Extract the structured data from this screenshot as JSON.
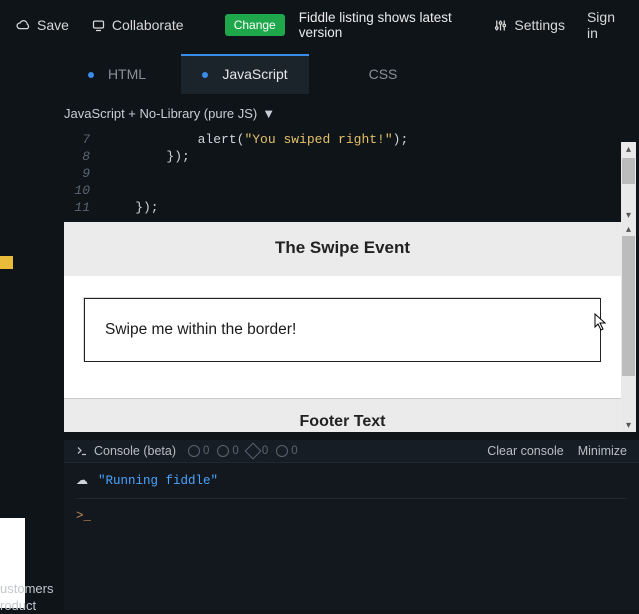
{
  "topbar": {
    "save": "Save",
    "collaborate": "Collaborate",
    "change": "Change",
    "status": "Fiddle listing shows latest version",
    "settings": "Settings",
    "signin": "Sign in"
  },
  "tabs": {
    "html": "HTML",
    "javascript": "JavaScript",
    "css": "CSS"
  },
  "framework": "JavaScript + No-Library (pure JS)",
  "code": {
    "l7": {
      "num": "7",
      "indent": "            ",
      "fn": "alert(",
      "str": "\"You swiped right!\"",
      "end": ");"
    },
    "l8": {
      "num": "8",
      "text": "        });"
    },
    "l9": {
      "num": "9",
      "text": ""
    },
    "l10": {
      "num": "10",
      "text": ""
    },
    "l11": {
      "num": "11",
      "text": "    });"
    }
  },
  "preview": {
    "header": "The Swipe Event",
    "swipe": "Swipe me within the border!",
    "footer": "Footer Text"
  },
  "console": {
    "title": "Console (beta)",
    "counts": [
      "0",
      "0",
      "0",
      "0"
    ],
    "clear": "Clear console",
    "minimize": "Minimize",
    "running": "\"Running fiddle\"",
    "prompt": ">_"
  },
  "side": {
    "line1": "ustomers",
    "line2": "roduct"
  }
}
